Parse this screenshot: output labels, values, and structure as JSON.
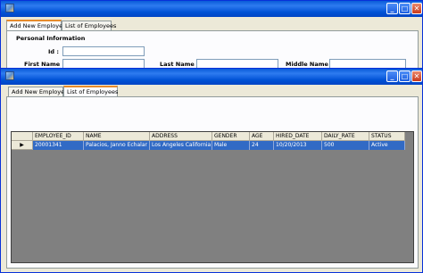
{
  "back_window": {
    "tabs": [
      {
        "label": "Add New Employee"
      },
      {
        "label": "List of Employees"
      }
    ],
    "group_title": "Personal Information",
    "fields": {
      "id": {
        "label": "Id :",
        "value": ""
      },
      "first_name": {
        "label": "First Name :",
        "value": ""
      },
      "last_name": {
        "label": "Last Name :",
        "value": ""
      },
      "middle_name": {
        "label": "Middle Name :",
        "value": ""
      }
    }
  },
  "front_window": {
    "tabs": [
      {
        "label": "Add New Employee"
      },
      {
        "label": "List of Employees"
      }
    ],
    "table": {
      "columns": [
        "EMPLOYEE_ID",
        "NAME",
        "ADDRESS",
        "GENDER",
        "AGE",
        "HIRED_DATE",
        "DAILY_RATE",
        "STATUS"
      ],
      "rows": [
        {
          "pointer": "▶",
          "cells": [
            "20001341",
            "Palacios, Janno Echalar",
            "Los Angeles California",
            "Male",
            "24",
            "10/20/2013",
            "500",
            "Active"
          ]
        }
      ]
    }
  },
  "controls": {
    "minimize": "_",
    "maximize": "□",
    "close": "✕"
  }
}
